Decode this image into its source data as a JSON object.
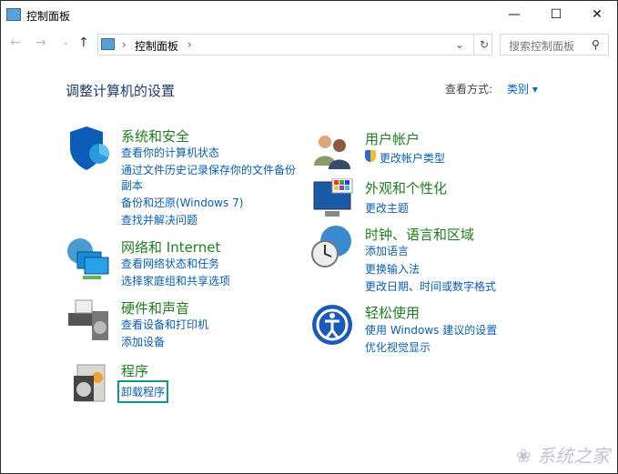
{
  "window": {
    "title": "控制面板",
    "minimize": "—",
    "maximize": "☐",
    "close": "✕"
  },
  "nav": {
    "back": "←",
    "forward": "→",
    "recent": "⌄",
    "up": "↑",
    "refresh": "↻",
    "dropdown": "⌄"
  },
  "address": {
    "sep1": "›",
    "crumb": "控制面板",
    "sep2": "›"
  },
  "search": {
    "placeholder": "搜索控制面板",
    "icon": "⚲"
  },
  "heading": "调整计算机的设置",
  "view": {
    "label": "查看方式:",
    "value": "类别 ▾"
  },
  "categories": [
    {
      "title": "系统和安全",
      "links": [
        "查看你的计算机状态",
        "通过文件历史记录保存你的文件备份",
        "副本",
        "备份和还原(Windows 7)",
        "查找并解决问题"
      ]
    },
    {
      "title": "网络和 Internet",
      "links": [
        "查看网络状态和任务",
        "选择家庭组和共享选项"
      ]
    },
    {
      "title": "硬件和声音",
      "links": [
        "查看设备和打印机",
        "添加设备"
      ]
    },
    {
      "title": "程序",
      "links": [
        "卸载程序"
      ]
    },
    {
      "title": "用户帐户",
      "links": [
        "更改帐户类型"
      ]
    },
    {
      "title": "外观和个性化",
      "links": [
        "更改主题"
      ]
    },
    {
      "title": "时钟、语言和区域",
      "links": [
        "添加语言",
        "更换输入法",
        "更改日期、时间或数字格式"
      ]
    },
    {
      "title": "轻松使用",
      "links": [
        "使用 Windows 建议的设置",
        "优化视觉显示"
      ]
    }
  ],
  "watermark": "系统之家"
}
